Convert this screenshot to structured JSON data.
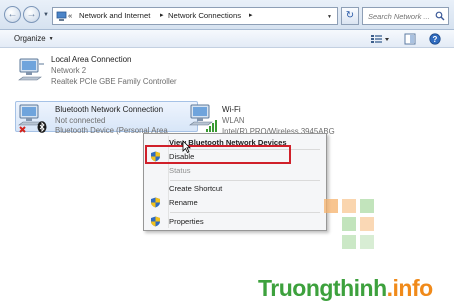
{
  "breadcrumb": {
    "overflow": "«",
    "items": [
      {
        "label": "Network and Internet"
      },
      {
        "label": "Network Connections"
      }
    ]
  },
  "search": {
    "placeholder": "Search Network ..."
  },
  "toolbar": {
    "organize_label": "Organize"
  },
  "connections": [
    {
      "name": "Local Area Connection",
      "status": "Network  2",
      "device": "Realtek PCIe GBE Family Controller"
    },
    {
      "name": "Bluetooth Network Connection",
      "status": "Not connected",
      "device": "Bluetooth Device (Personal Area"
    },
    {
      "name": "Wi-Fi",
      "status": "WLAN",
      "device": "Intel(R) PRO/Wireless 3945ABG"
    }
  ],
  "context_menu": {
    "items": [
      {
        "label": "View Bluetooth Network Devices"
      },
      {
        "label": "Disable"
      },
      {
        "label": "Status"
      },
      {
        "label": "Create Shortcut"
      },
      {
        "label": "Rename"
      },
      {
        "label": "Properties"
      }
    ]
  },
  "watermark": {
    "name": "Truongthinh",
    "dot": ".",
    "tld": "info"
  },
  "colors": {
    "highlight_box": "#d0202a",
    "watermark_green": "#3da13d",
    "watermark_orange": "#f08a1a"
  },
  "icons": [
    "back-arrow-icon",
    "forward-arrow-icon",
    "network-connections-icon",
    "refresh-icon",
    "search-icon",
    "view-options-icon",
    "preview-pane-icon",
    "help-icon",
    "network-adapter-icon",
    "bluetooth-icon",
    "wifi-signal-icon",
    "uac-shield-icon"
  ]
}
